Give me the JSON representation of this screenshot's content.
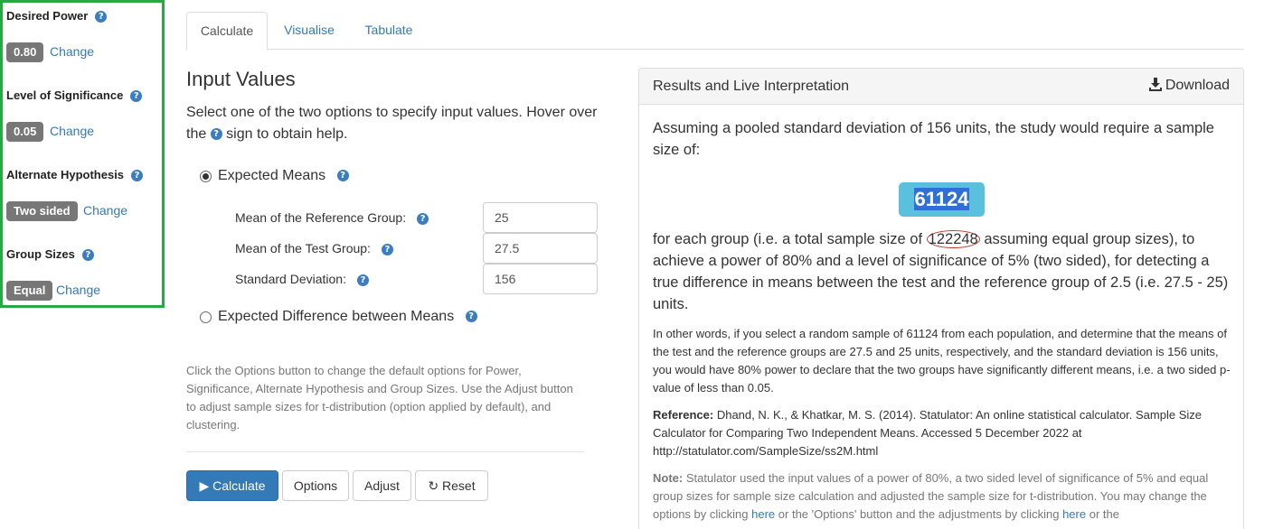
{
  "left_panel": {
    "power": {
      "title": "Desired Power",
      "value": "0.80",
      "change": "Change"
    },
    "significance": {
      "title": "Level of Significance",
      "value": "0.05",
      "change": "Change"
    },
    "hypothesis": {
      "title": "Alternate Hypothesis",
      "value": "Two sided",
      "change": "Change"
    },
    "group_sizes": {
      "title": "Group Sizes",
      "value": "Equal",
      "change": "Change"
    },
    "border_color": "#28a745"
  },
  "tabs": [
    "Calculate",
    "Visualise",
    "Tabulate"
  ],
  "input": {
    "title": "Input Values",
    "desc_before": "Select one of the two options to specify input values. Hover over the",
    "desc_after": "sign to obtain help.",
    "option1": "Expected Means",
    "option2": "Expected Difference between Means",
    "fields": [
      {
        "label": "Mean of the Reference Group:",
        "value": "25"
      },
      {
        "label": "Mean of the Test Group:",
        "value": "27.5"
      },
      {
        "label": "Standard Deviation:",
        "value": "156"
      }
    ],
    "note": "Click the Options button to change the default options for Power, Significance, Alternate Hypothesis and Group Sizes. Use the Adjust button to adjust sample sizes for t-distribution (option applied by default), and clustering."
  },
  "buttons": {
    "calculate": "Calculate",
    "options": "Options",
    "adjust": "Adjust",
    "reset": "Reset"
  },
  "results": {
    "title": "Results and Live Interpretation",
    "download": "Download",
    "intro": "Assuming a pooled standard deviation of 156 units, the study would require a sample size of:",
    "sample_size": "61124",
    "para1_a": "for each group (i.e. a total sample size of",
    "total": "122248",
    "para1_b": "assuming equal group sizes), to achieve a power of 80% and a level of significance of 5% (two sided), for detecting a true difference in means between the test and the reference group of 2.5 (i.e. 27.5 - 25) units.",
    "para2": "In other words, if you select a random sample of 61124 from each population, and determine that the means of the test and the reference groups are 27.5 and 25 units, respectively, and the standard deviation is 156 units, you would have 80% power to declare that the two groups have significantly different means, i.e. a two sided p-value of less than 0.05.",
    "ref_label": "Reference:",
    "ref_text": "Dhand, N. K., & Khatkar, M. S. (2014). Statulator: An online statistical calculator. Sample Size Calculator for Comparing Two Independent Means. Accessed 5 December 2022 at http://statulator.com/SampleSize/ss2M.html",
    "note_label": "Note:",
    "note_a": "Statulator used the input values of a power of 80%, a two sided level of significance of 5% and equal group sizes for sample size calculation and adjusted the sample size for t-distribution. You may change the options by clicking",
    "note_link1": "here",
    "note_b": "or the 'Options' button and the adjustments by clicking",
    "note_link2": "here",
    "note_c": "or the"
  }
}
